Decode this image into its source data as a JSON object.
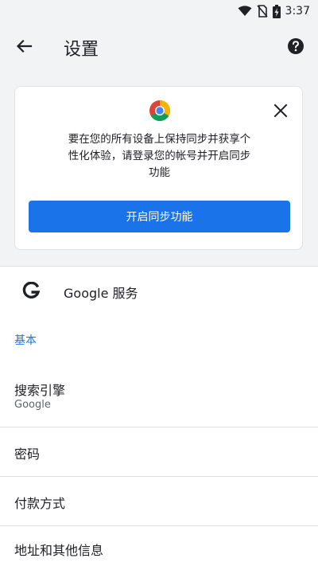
{
  "status_bar": {
    "time": "3:37",
    "icons": [
      "wifi-icon",
      "no-sim-icon",
      "battery-charging-icon"
    ]
  },
  "app_bar": {
    "title": "设置",
    "back_icon": "arrow-back-icon",
    "help_icon": "help-circle-icon"
  },
  "sync_card": {
    "logo_icon": "chrome-logo-icon",
    "close_icon": "close-icon",
    "message_lines": [
      "要在您的所有设备上保持同步并获享个",
      "性化体验，请登录您的帐号并开启同步",
      "功能"
    ],
    "button_label": "开启同步功能"
  },
  "google_services": {
    "icon": "google-g-icon",
    "label": "Google 服务"
  },
  "section_basic": "基本",
  "settings_items": [
    {
      "title": "搜索引擎",
      "subtitle": "Google"
    },
    {
      "title": "密码"
    },
    {
      "title": "付款方式"
    },
    {
      "title": "地址和其他信息"
    }
  ],
  "colors": {
    "accent": "#1a73e8",
    "header_bg": "#f1f3f4",
    "text_primary": "#202124",
    "text_secondary": "#5f6368"
  }
}
